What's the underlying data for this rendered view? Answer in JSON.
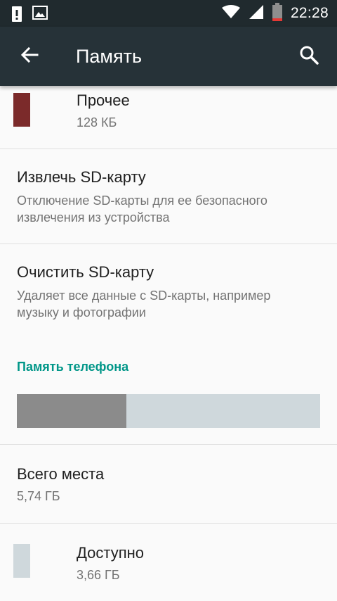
{
  "status_bar": {
    "time": "22:28",
    "icons": [
      "alert-icon",
      "image-notification-icon",
      "wifi-icon",
      "signal-icon",
      "battery-icon"
    ]
  },
  "app_bar": {
    "title": "Память",
    "back_icon": "arrow-back-icon",
    "search_icon": "search-icon"
  },
  "items": {
    "other": {
      "title": "Прочее",
      "value": "128 КБ",
      "color": "#7b2a2a"
    },
    "eject_sd": {
      "title": "Извлечь SD-карту",
      "summary_line1": "Отключение SD-карты для ее безопасного",
      "summary_line2": "извлечения из устройства"
    },
    "erase_sd": {
      "title": "Очистить SD-карту",
      "summary_line1": "Удаляет все данные с SD-карты, например",
      "summary_line2": "музыку и фотографии"
    },
    "phone_storage_header": "Память телефона",
    "usage_bar": {
      "used_fraction": 0.361,
      "used_color": "#8b8b8b",
      "free_color": "#cfd8dc"
    },
    "total": {
      "title": "Всего места",
      "value": "5,74 ГБ"
    },
    "available": {
      "title": "Доступно",
      "value": "3,66 ГБ",
      "color": "#cfd8dc"
    }
  },
  "colors": {
    "status_bar": "#202a2e",
    "app_bar": "#263238",
    "accent": "#009688",
    "background": "#fafafa"
  }
}
